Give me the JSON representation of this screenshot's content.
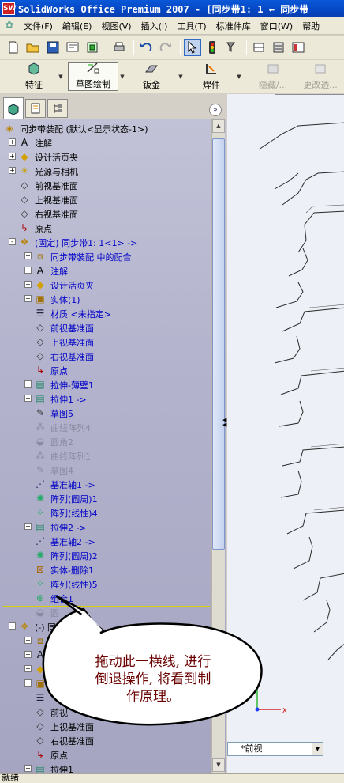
{
  "window": {
    "title": "SolidWorks Office Premium 2007 - [同步带1: 1 ← 同步带"
  },
  "menu": [
    "文件(F)",
    "编辑(E)",
    "视图(V)",
    "插入(I)",
    "工具(T)",
    "标准件库",
    "窗口(W)",
    "帮助"
  ],
  "command_manager": {
    "tabs": [
      {
        "label": "特征",
        "icon": "feature-icon",
        "state": "normal"
      },
      {
        "label": "草图绘制",
        "icon": "sketch-icon",
        "state": "active"
      },
      {
        "label": "钣金",
        "icon": "sheetmetal-icon",
        "state": "normal"
      },
      {
        "label": "焊件",
        "icon": "weldment-icon",
        "state": "normal"
      },
      {
        "label": "隐藏/...",
        "icon": "hide-show-icon",
        "state": "disabled"
      },
      {
        "label": "更改透...",
        "icon": "transparency-icon",
        "state": "disabled"
      }
    ]
  },
  "tree": {
    "items": [
      {
        "label": "同步带装配  (默认<显示状态-1>)",
        "icon": "assembly-icon",
        "color": "black",
        "expander": "",
        "level": 0
      },
      {
        "label": "注解",
        "icon": "annotation-icon",
        "color": "black",
        "expander": "+",
        "level": 1
      },
      {
        "label": "设计活页夹",
        "icon": "design-binder-icon",
        "color": "black",
        "expander": "+",
        "level": 1
      },
      {
        "label": "光源与相机",
        "icon": "lights-camera-icon",
        "color": "black",
        "expander": "+",
        "level": 1
      },
      {
        "label": "前视基准面",
        "icon": "plane-icon",
        "color": "black",
        "expander": "",
        "level": 1
      },
      {
        "label": "上视基准面",
        "icon": "plane-icon",
        "color": "black",
        "expander": "",
        "level": 1
      },
      {
        "label": "右视基准面",
        "icon": "plane-icon",
        "color": "black",
        "expander": "",
        "level": 1
      },
      {
        "label": "原点",
        "icon": "origin-icon",
        "color": "black",
        "expander": "",
        "level": 1
      },
      {
        "label": "(固定) 同步带1: 1<1> ->",
        "icon": "part-icon",
        "color": "blue",
        "expander": "-",
        "level": 1
      },
      {
        "label": "同步带装配 中的配合",
        "icon": "mates-icon",
        "color": "blue",
        "expander": "+",
        "level": 2
      },
      {
        "label": "注解",
        "icon": "annotation-icon",
        "color": "blue",
        "expander": "+",
        "level": 2
      },
      {
        "label": "设计活页夹",
        "icon": "design-binder-icon",
        "color": "blue",
        "expander": "+",
        "level": 2
      },
      {
        "label": "实体(1)",
        "icon": "solid-bodies-icon",
        "color": "blue",
        "expander": "+",
        "level": 2
      },
      {
        "label": "材质 <未指定>",
        "icon": "material-icon",
        "color": "blue",
        "expander": "",
        "level": 2
      },
      {
        "label": "前视基准面",
        "icon": "plane-icon",
        "color": "blue",
        "expander": "",
        "level": 2
      },
      {
        "label": "上视基准面",
        "icon": "plane-icon",
        "color": "blue",
        "expander": "",
        "level": 2
      },
      {
        "label": "右视基准面",
        "icon": "plane-icon",
        "color": "blue",
        "expander": "",
        "level": 2
      },
      {
        "label": "原点",
        "icon": "origin-icon",
        "color": "blue",
        "expander": "",
        "level": 2
      },
      {
        "label": "拉伸-薄壁1",
        "icon": "extrude-icon",
        "color": "blue",
        "expander": "+",
        "level": 2
      },
      {
        "label": "拉伸1 ->",
        "icon": "extrude-icon",
        "color": "blue",
        "expander": "+",
        "level": 2
      },
      {
        "label": "草图5",
        "icon": "sketch-icon",
        "color": "blue",
        "expander": "",
        "level": 2
      },
      {
        "label": "曲线阵列4",
        "icon": "curve-pattern-icon",
        "color": "gray",
        "expander": "",
        "level": 2
      },
      {
        "label": "圆角2",
        "icon": "fillet-icon",
        "color": "gray",
        "expander": "",
        "level": 2
      },
      {
        "label": "曲线阵列1",
        "icon": "curve-pattern-icon",
        "color": "gray",
        "expander": "",
        "level": 2
      },
      {
        "label": "草图4",
        "icon": "sketch-icon",
        "color": "gray",
        "expander": "",
        "level": 2
      },
      {
        "label": "基准轴1 ->",
        "icon": "axis-icon",
        "color": "blue",
        "expander": "",
        "level": 2
      },
      {
        "label": "阵列(圆周)1",
        "icon": "circular-pattern-icon",
        "color": "blue",
        "expander": "",
        "level": 2
      },
      {
        "label": "阵列(线性)4",
        "icon": "linear-pattern-icon",
        "color": "blue",
        "expander": "",
        "level": 2
      },
      {
        "label": "拉伸2 ->",
        "icon": "extrude-icon",
        "color": "blue",
        "expander": "+",
        "level": 2
      },
      {
        "label": "基准轴2 ->",
        "icon": "axis-icon",
        "color": "blue",
        "expander": "",
        "level": 2
      },
      {
        "label": "阵列(圆周)2",
        "icon": "circular-pattern-icon",
        "color": "blue",
        "expander": "",
        "level": 2
      },
      {
        "label": "实体-删除1",
        "icon": "delete-body-icon",
        "color": "blue",
        "expander": "",
        "level": 2
      },
      {
        "label": "阵列(线性)5",
        "icon": "linear-pattern-icon",
        "color": "blue",
        "expander": "",
        "level": 2
      },
      {
        "label": "组合1",
        "icon": "combine-icon",
        "color": "blue",
        "expander": "",
        "level": 2
      },
      {
        "label": "圆",
        "icon": "fillet-icon",
        "color": "gray",
        "expander": "",
        "level": 2
      },
      {
        "label": "(-) 同",
        "icon": "part-icon",
        "color": "black",
        "expander": "-",
        "level": 1
      },
      {
        "label": "同步",
        "icon": "mates-icon",
        "color": "black",
        "expander": "+",
        "level": 2
      },
      {
        "label": "",
        "icon": "annotation-icon",
        "color": "black",
        "expander": "+",
        "level": 2
      },
      {
        "label": "",
        "icon": "design-binder-icon",
        "color": "black",
        "expander": "+",
        "level": 2
      },
      {
        "label": "",
        "icon": "solid-bodies-icon",
        "color": "black",
        "expander": "+",
        "level": 2
      },
      {
        "label": "",
        "icon": "material-icon",
        "color": "black",
        "expander": "",
        "level": 2
      },
      {
        "label": "前视",
        "icon": "plane-icon",
        "color": "black",
        "expander": "",
        "level": 2
      },
      {
        "label": "上视基准面",
        "icon": "plane-icon",
        "color": "black",
        "expander": "",
        "level": 2
      },
      {
        "label": "右视基准面",
        "icon": "plane-icon",
        "color": "black",
        "expander": "",
        "level": 2
      },
      {
        "label": "原点",
        "icon": "origin-icon",
        "color": "black",
        "expander": "",
        "level": 2
      },
      {
        "label": "拉伸1",
        "icon": "extrude-icon",
        "color": "black",
        "expander": "+",
        "level": 2
      }
    ]
  },
  "callout": {
    "line1": "拖动此一横线, 进行",
    "line2": "倒退操作, 将看到制",
    "line3": "作原理。"
  },
  "graphics": {
    "view_name": "*前视",
    "axis_x": "X",
    "axis_y": "Y"
  },
  "status": {
    "text": "就绪"
  },
  "colors": {
    "title_bar": "#0a58d8",
    "tree_blue": "#0000c8",
    "rollback_bar": "#d8d000",
    "callout_text": "#6a0000"
  }
}
